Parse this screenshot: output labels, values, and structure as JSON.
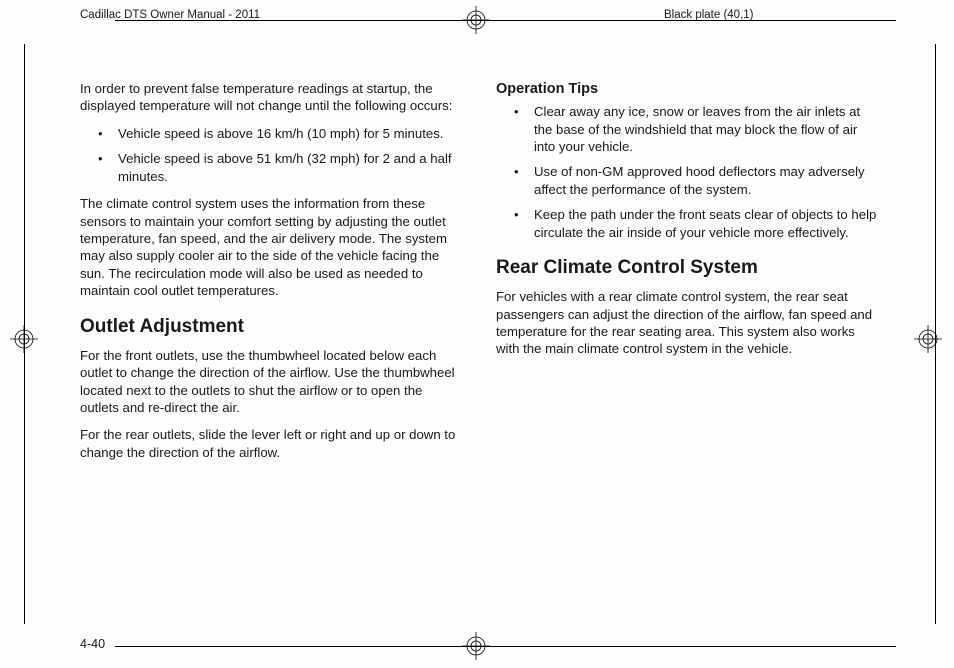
{
  "header": {
    "left": "Cadillac DTS Owner Manual - 2011",
    "right": "Black plate (40,1)"
  },
  "page_number": "4-40",
  "left_col": {
    "intro": "In order to prevent false temperature readings at startup, the displayed temperature will not change until the following occurs:",
    "intro_bullets": [
      "Vehicle speed is above 16 km/h (10 mph) for 5 minutes.",
      "Vehicle speed is above 51 km/h (32 mph) for 2 and a half minutes."
    ],
    "sensors": "The climate control system uses the information from these sensors to maintain your comfort setting by adjusting the outlet temperature, fan speed, and the air delivery mode. The system may also supply cooler air to the side of the vehicle facing the sun. The recirculation mode will also be used as needed to maintain cool outlet temperatures.",
    "outlet_heading": "Outlet Adjustment",
    "outlet_p1": "For the front outlets, use the thumbwheel located below each outlet to change the direction of the airflow. Use the thumbwheel located next to the outlets to shut the airflow or to open the outlets and re-direct the air.",
    "outlet_p2": "For the rear outlets, slide the lever left or right and up or down to change the direction of the airflow."
  },
  "right_col": {
    "tips_heading": "Operation Tips",
    "tips": [
      "Clear away any ice, snow or leaves from the air inlets at the base of the windshield that may block the flow of air into your vehicle.",
      "Use of non-GM approved hood deflectors may adversely affect the performance of the system.",
      "Keep the path under the front seats clear of objects to help circulate the air inside of your vehicle more effectively."
    ],
    "rear_heading": "Rear Climate Control System",
    "rear_p": "For vehicles with a rear climate control system, the rear seat passengers can adjust the direction of the airflow, fan speed and temperature for the rear seating area. This system also works with the main climate control system in the vehicle."
  }
}
